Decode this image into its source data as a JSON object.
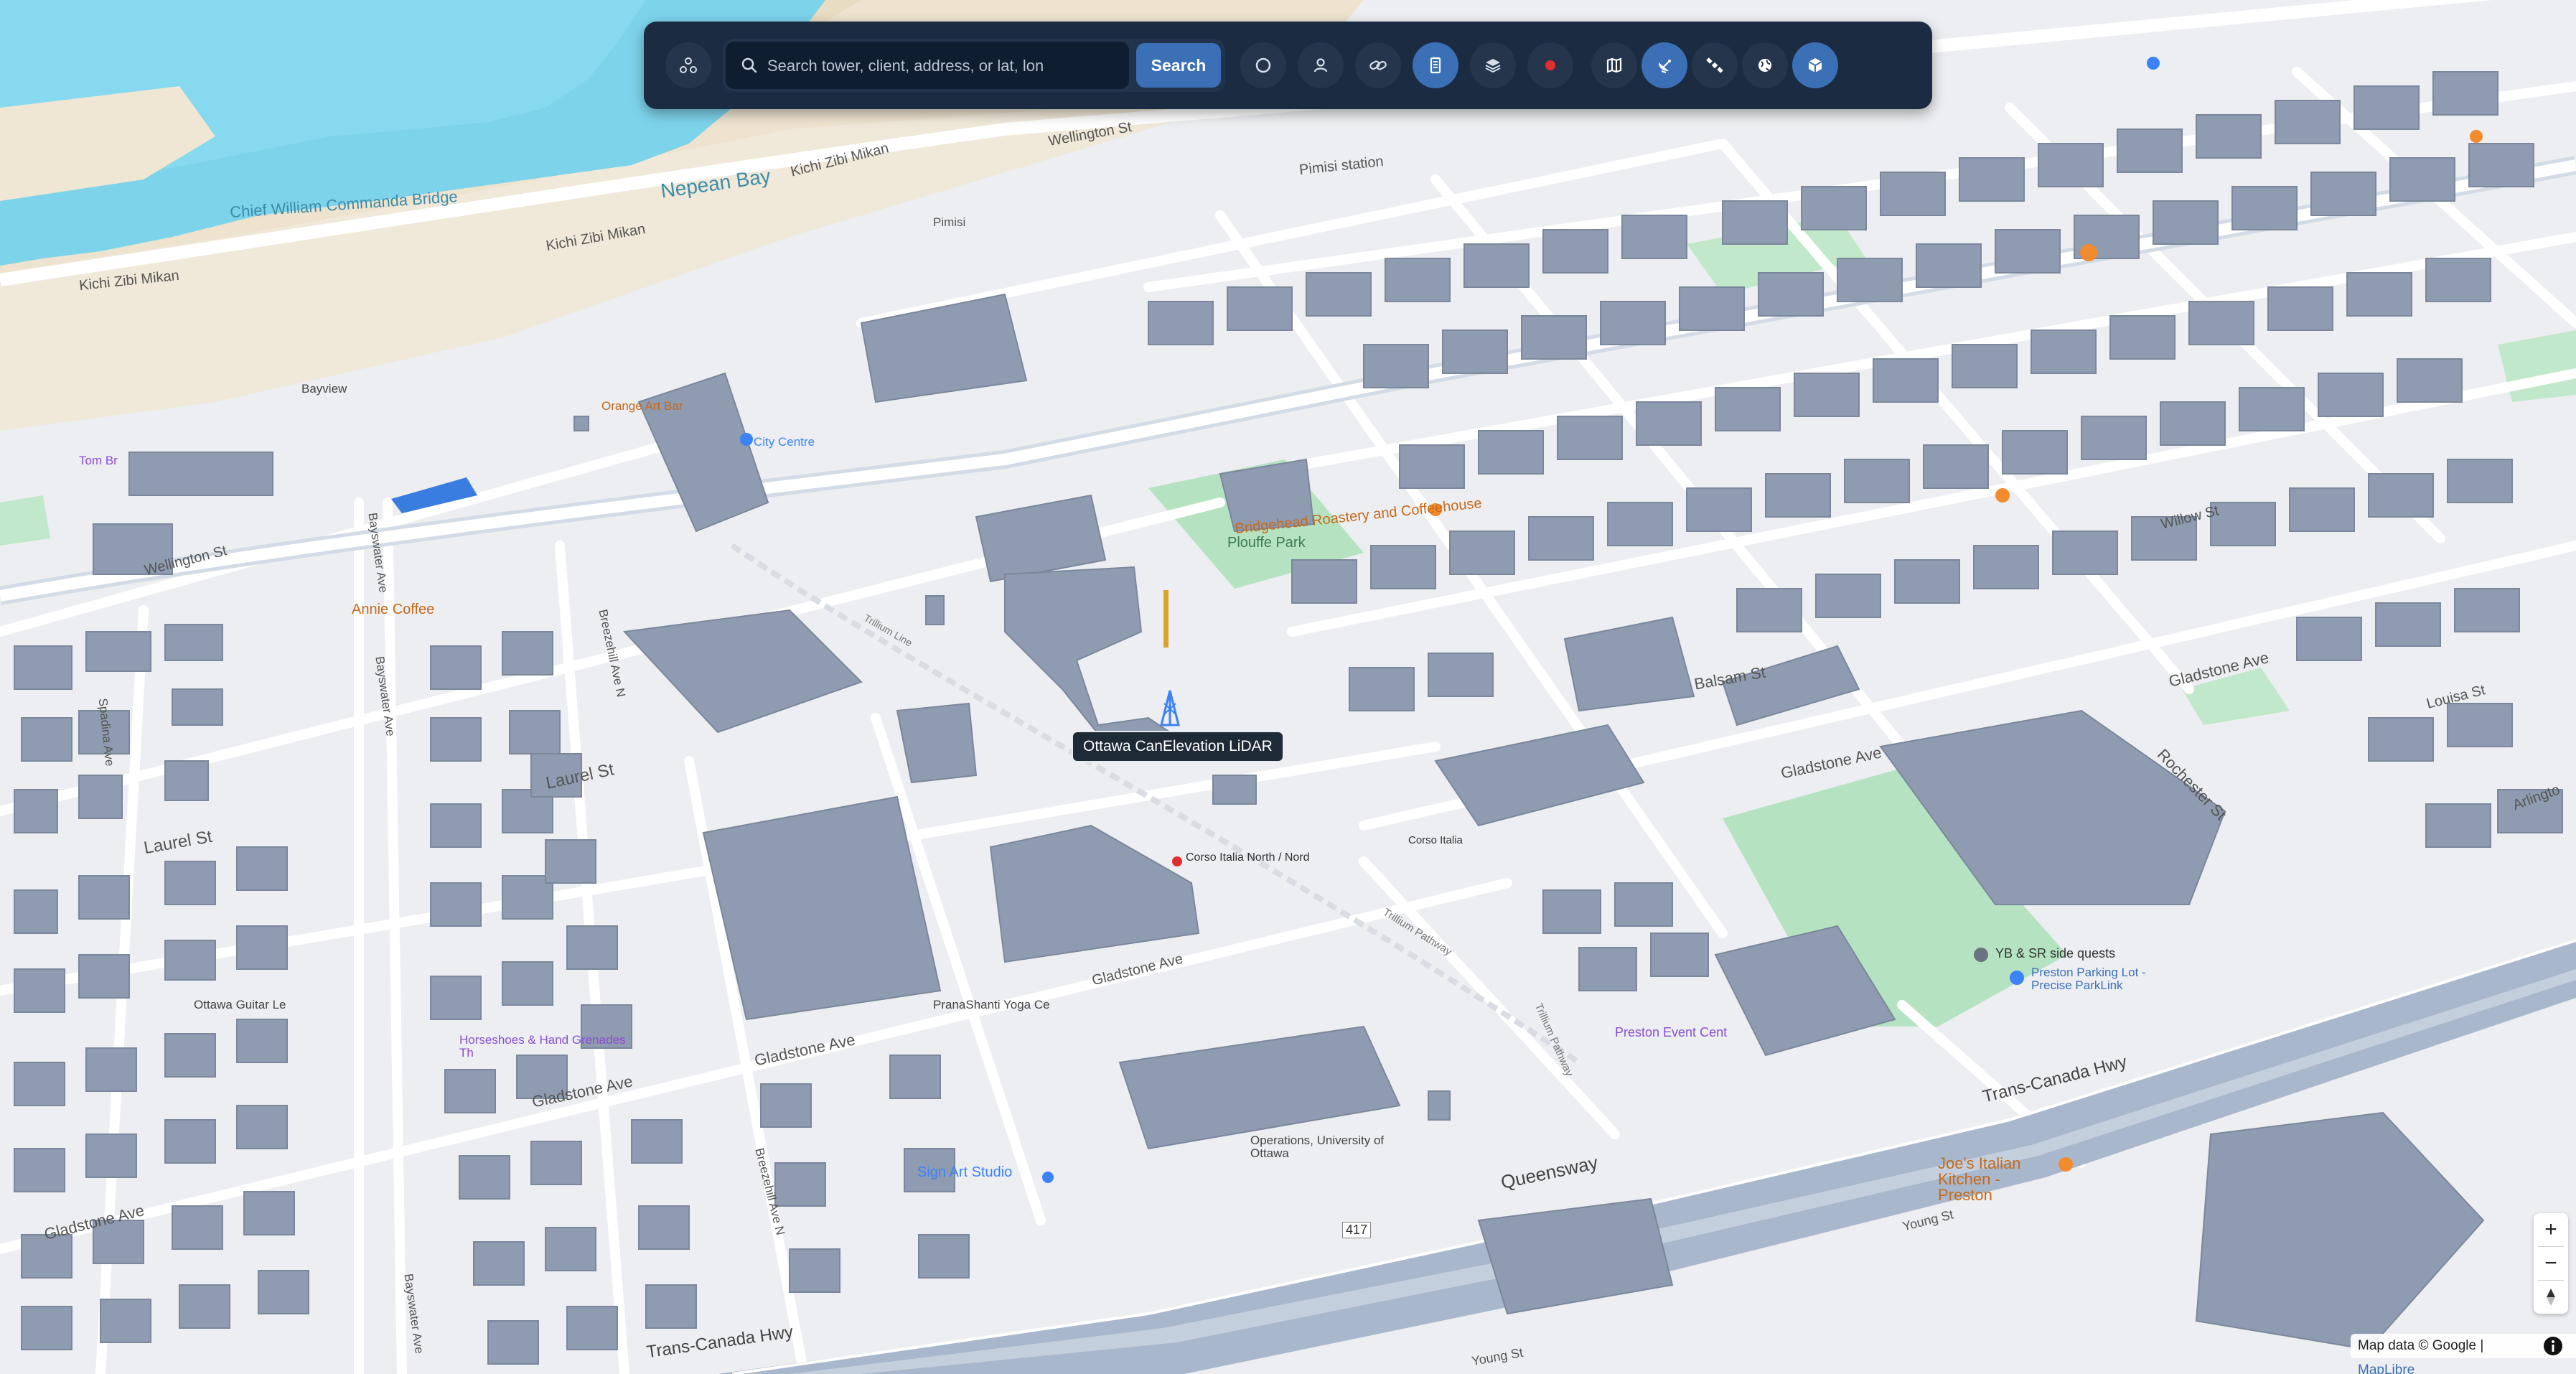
{
  "toolbar": {
    "search_placeholder": "Search tower, client, address, or lat, lon",
    "search_button": "Search"
  },
  "tooltip": {
    "label": "Ottawa CanElevation LiDAR"
  },
  "map_labels": {
    "wellington_st_top": "Wellington St",
    "nepean_bay": "Nepean Bay",
    "kichi_zibi_mikan_1": "Kichi Zibi Mikan",
    "kichi_zibi_mikan_2": "Kichi Zibi Mikan",
    "kichi_zibi_mikan_3": "Kichi Zibi Mikan",
    "chief_william_commanda_bridge": "Chief William Commanda Bridge",
    "pimisi_station": "Pimisi station",
    "bayview": "Bayview",
    "orange_art_bar": "Orange Art Bar",
    "city_centre": "City Centre",
    "plouffe_park": "Plouffe Park",
    "bridgehead_roastery": "Bridgehead Roastery and Coffeehouse",
    "wellington_st_left": "Wellington St",
    "annie_coffee": "Annie Coffee",
    "laurel_st_1": "Laurel St",
    "laurel_st_2": "Laurel St",
    "gladstone_ave_1": "Gladstone Ave",
    "gladstone_ave_2": "Gladstone Ave",
    "gladstone_ave_3": "Gladstone Ave",
    "gladstone_ave_4": "Gladstone Ave",
    "gladstone_ave_5": "Gladstone Ave",
    "gladstone_ave_6": "Gladstone Ave",
    "corso_italia_north": "Corso Italia North / Nord",
    "corso_italia": "Corso Italia",
    "trillium_pathway_1": "Trillium Pathway",
    "trillium_pathway_2": "Trillium Pathway",
    "balsam_st": "Balsam St",
    "willow_st": "Willow St",
    "rochester_st": "Rochester St",
    "louisa_st": "Louisa St",
    "arlington": "Arlingto",
    "queensway": "Queensway",
    "trans_canada_hwy_1": "Trans-Canada Hwy",
    "trans_canada_hwy_2": "Trans-Canada Hwy",
    "highway_417": "417",
    "joes_italian_kitchen": "Joe's Italian Kitchen - Preston",
    "preston_event_centre": "Preston Event Cent",
    "yb_sr_side_quests": "YB & SR side quests",
    "preston_parking": "Preston Parking Lot - Precise ParkLink",
    "sign_art_studio": "Sign Art Studio",
    "pranashanti_yoga": "PranaShanti Yoga Ce",
    "ottawa_guitar": "Ottawa Guitar Le",
    "horseshoes_grenades": "Horseshoes & Hand Grenades Th",
    "young_st_1": "Young St",
    "young_st_2": "Young St",
    "bayswater_ave_1": "Bayswater Ave",
    "bayswater_ave_2": "Bayswater Ave",
    "bayswater_ave_3": "Bayswater Ave",
    "breezehill_ave_n_1": "Breezehill Ave N",
    "breezehill_ave_n_2": "Breezehill Ave N",
    "spadina_ave": "Spadina Ave",
    "ottawa_operations": "Operations, University of Ottawa",
    "tom_brown": "Tom Br",
    "trillium_line": "Trillium Line",
    "pimisi": "Pimisi"
  },
  "zoom": {
    "zoom_in": "+",
    "zoom_out": "−"
  },
  "attribution": {
    "text": "Map data © Google | ",
    "library": "MapLibre"
  },
  "colors": {
    "toolbar_bg": "#1a2b42",
    "accent": "#3b6fb6",
    "water": "#7dd3ea",
    "park": "#b5e3c2",
    "building": "#8e9bb0",
    "highway": "#a8b7cc",
    "land": "#eceef1",
    "sand": "#ede3cf",
    "record_red": "#e02d2d",
    "tower_yellow": "#d7a52a"
  }
}
